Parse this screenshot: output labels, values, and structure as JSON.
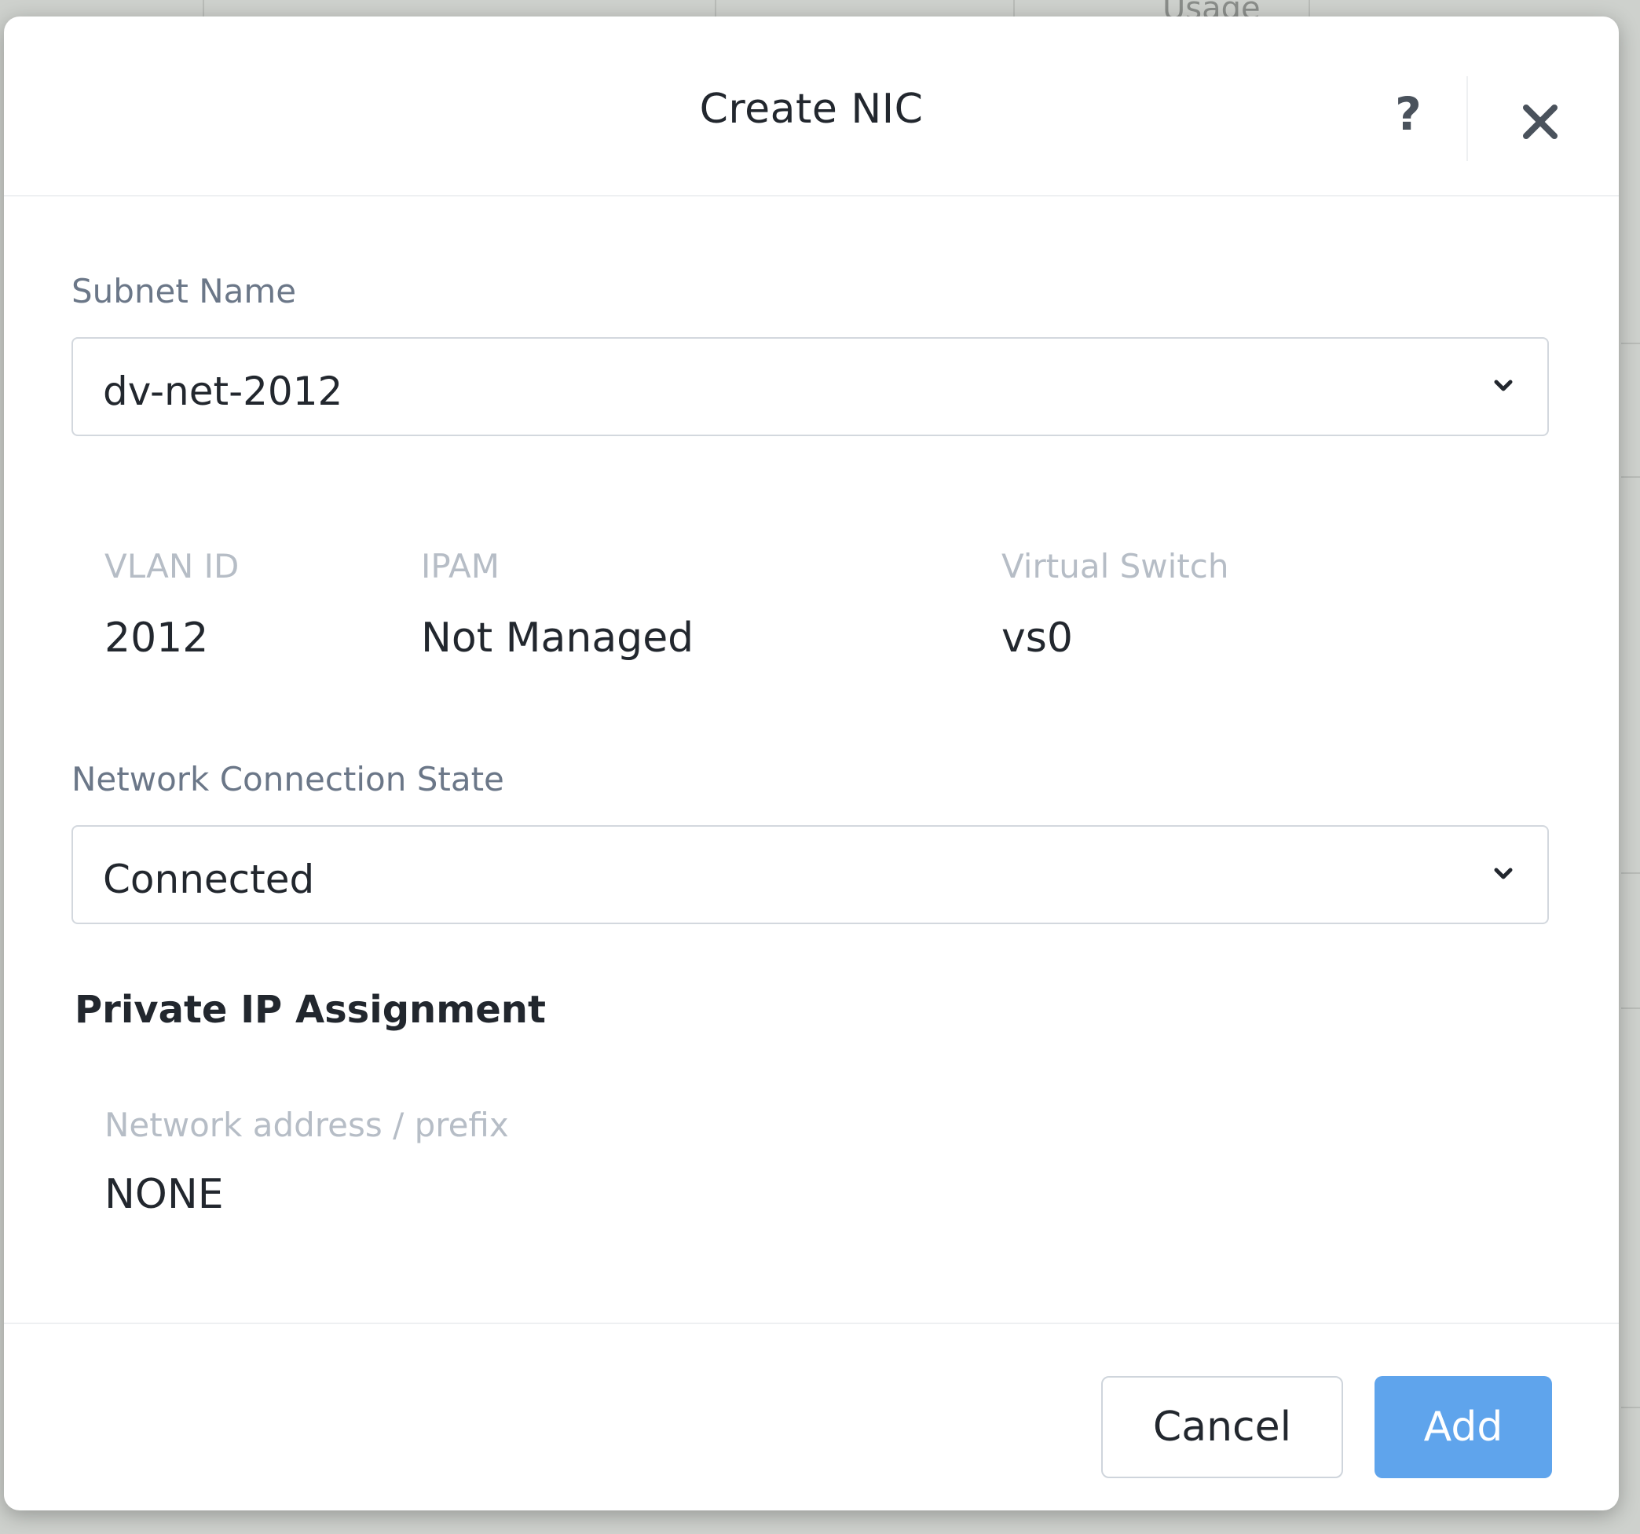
{
  "background": {
    "column_header": "Usage"
  },
  "dialog": {
    "title": "Create NIC",
    "help_label": "?",
    "icons": {
      "help": "question-mark-icon",
      "close": "close-icon",
      "dropdown": "chevron-down-icon"
    }
  },
  "subnet": {
    "label": "Subnet Name",
    "value": "dv-net-2012"
  },
  "details": {
    "vlan_id": {
      "label": "VLAN ID",
      "value": "2012"
    },
    "ipam": {
      "label": "IPAM",
      "value": "Not Managed"
    },
    "virtual_switch": {
      "label": "Virtual Switch",
      "value": "vs0"
    }
  },
  "connection_state": {
    "label": "Network Connection State",
    "value": "Connected"
  },
  "private_ip": {
    "title": "Private IP Assignment",
    "network_label": "Network address / prefix",
    "network_value": "NONE"
  },
  "footer": {
    "cancel_label": "Cancel",
    "add_label": "Add"
  },
  "colors": {
    "primary": "#5fa4ec",
    "text": "#22272e",
    "label": "#6b7788",
    "muted_label": "#b6bdc6"
  }
}
